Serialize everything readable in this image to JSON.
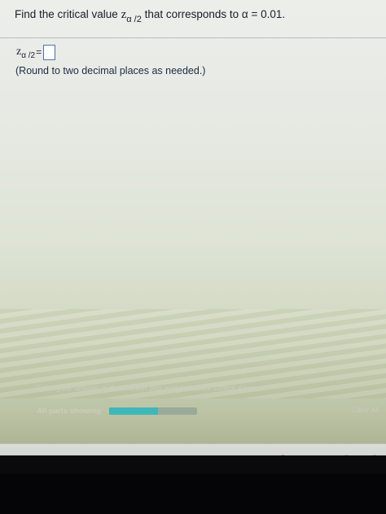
{
  "question": {
    "prefix": "Find the critical value",
    "var": "z",
    "subscript": "α /2",
    "suffix": "that corresponds to α = 0.01."
  },
  "answer": {
    "var": "z",
    "subscript": "α /2",
    "equals": "=",
    "value": ""
  },
  "hint": "(Round to two decimal places as needed.)",
  "footer": {
    "instruction": "Enter your answer in the answer box and then click Check Answer.",
    "parts_label": "All parts showing",
    "progress": 0.55,
    "clear_label": "Clear All"
  },
  "colors": {
    "progress_fill": "#3fb6b8",
    "answer_box_border": "#4f6fb3",
    "text": "#1c1c2a"
  },
  "taskbar": {
    "icons": [
      "microphone-icon",
      "task-view-icon",
      "edge-icon",
      "file-explorer-icon",
      "store-icon",
      "home-icon",
      "chrome-icon",
      "internet-explorer-icon",
      "skype-icon",
      "app-icon"
    ]
  }
}
